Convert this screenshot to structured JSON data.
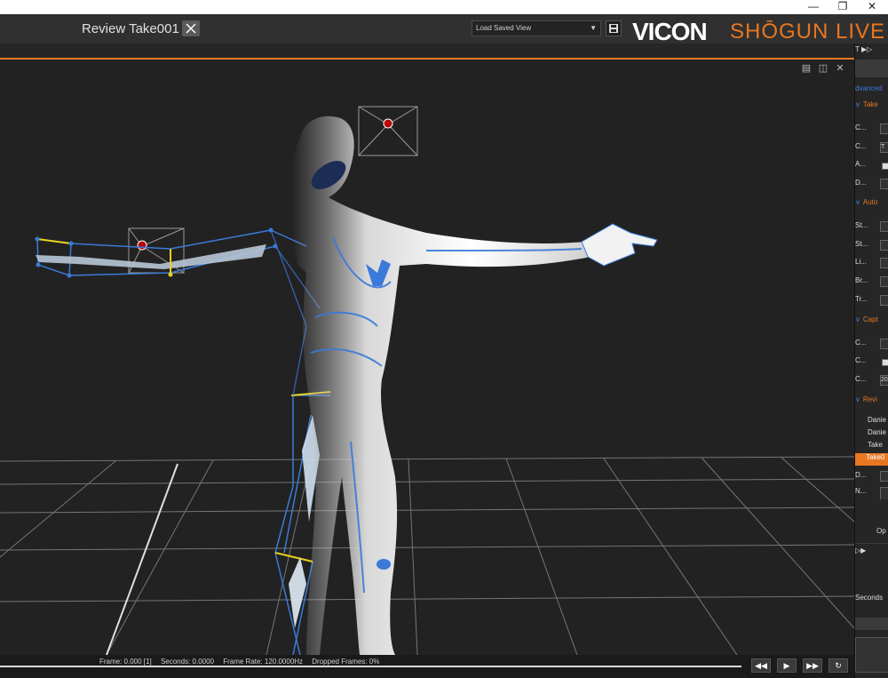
{
  "window": {
    "minimize_icon": "minimize-icon",
    "restore_icon": "restore-icon",
    "close_icon": "close-icon"
  },
  "header": {
    "take_title": "Review  Take001",
    "view_select": {
      "value": "Load Saved View"
    },
    "brand": {
      "vicon": "VICON",
      "product": "SHŌGUN LIVE"
    }
  },
  "status": {
    "frame": "Frame: 0.000 [1]",
    "seconds": "Seconds: 0.0000",
    "frame_rate": "Frame Rate: 120.0000Hz",
    "dropped": "Dropped Frames: 0%"
  },
  "panel": {
    "tab_label": "T",
    "advanced": "dvanced",
    "sections": {
      "take": "Take",
      "auto": "Auto",
      "capture": "Capt",
      "review": "Revi"
    },
    "take_rows": [
      "C...",
      "C...",
      "A...",
      "D..."
    ],
    "take_row_values": [
      "",
      "T",
      "",
      ""
    ],
    "auto_rows": [
      "St...",
      "St...",
      "Li...",
      "Br...",
      "Tr..."
    ],
    "capture_rows": [
      "C...",
      "C...",
      "C..."
    ],
    "capture_value": "20",
    "review_items": [
      "Danie",
      "Danie",
      "Take",
      "Take0"
    ],
    "review_rows": [
      "D...",
      "N..."
    ],
    "options_label": "Op",
    "seconds_label": "Seconds"
  },
  "colors": {
    "accent": "#e87722",
    "marker_blue": "#3b7ad9",
    "marker_yellow": "#e8d21e"
  }
}
